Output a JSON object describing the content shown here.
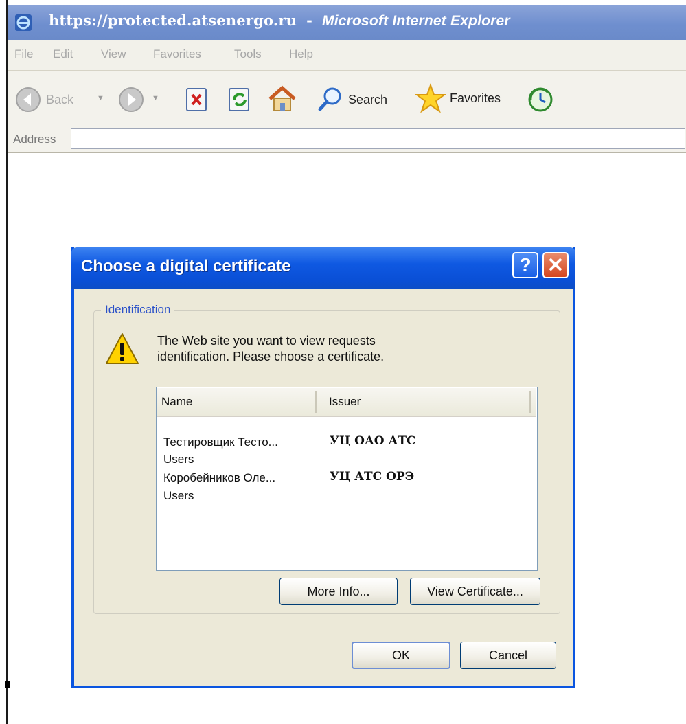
{
  "window": {
    "url": "https://protected.atsenergo.ru",
    "separator": "-",
    "app_name": "Microsoft Internet Explorer"
  },
  "menu": {
    "items": [
      "File",
      "Edit",
      "View",
      "Favorites",
      "Tools",
      "Help"
    ]
  },
  "toolbar": {
    "back_label": "Back",
    "search_label": "Search",
    "favorites_label": "Favorites"
  },
  "address": {
    "label": "Address",
    "value": ""
  },
  "dialog": {
    "title": "Choose a digital certificate",
    "help_glyph": "?",
    "close_glyph": "✕",
    "group_label": "Identification",
    "message_lines": [
      "The Web site you want to view requests",
      "identification. Please choose a certificate."
    ],
    "columns": {
      "name": "Name",
      "issuer": "Issuer"
    },
    "certificates": [
      {
        "name": "Тестировщик Тесто...",
        "store": "Users",
        "issuer": "УЦ ОАО АТС"
      },
      {
        "name": "Коробейников Оле...",
        "store": "Users",
        "issuer": "УЦ АТС ОРЭ"
      }
    ],
    "buttons": {
      "more_info": "More Info...",
      "view_certificate": "View Certificate...",
      "ok": "OK",
      "cancel": "Cancel"
    }
  },
  "colors": {
    "dialog_title_blue": "#0a55e0",
    "dialog_body": "#ece9d8",
    "browser_title_blue": "#7a96d4",
    "group_label_blue": "#2b51c8"
  }
}
